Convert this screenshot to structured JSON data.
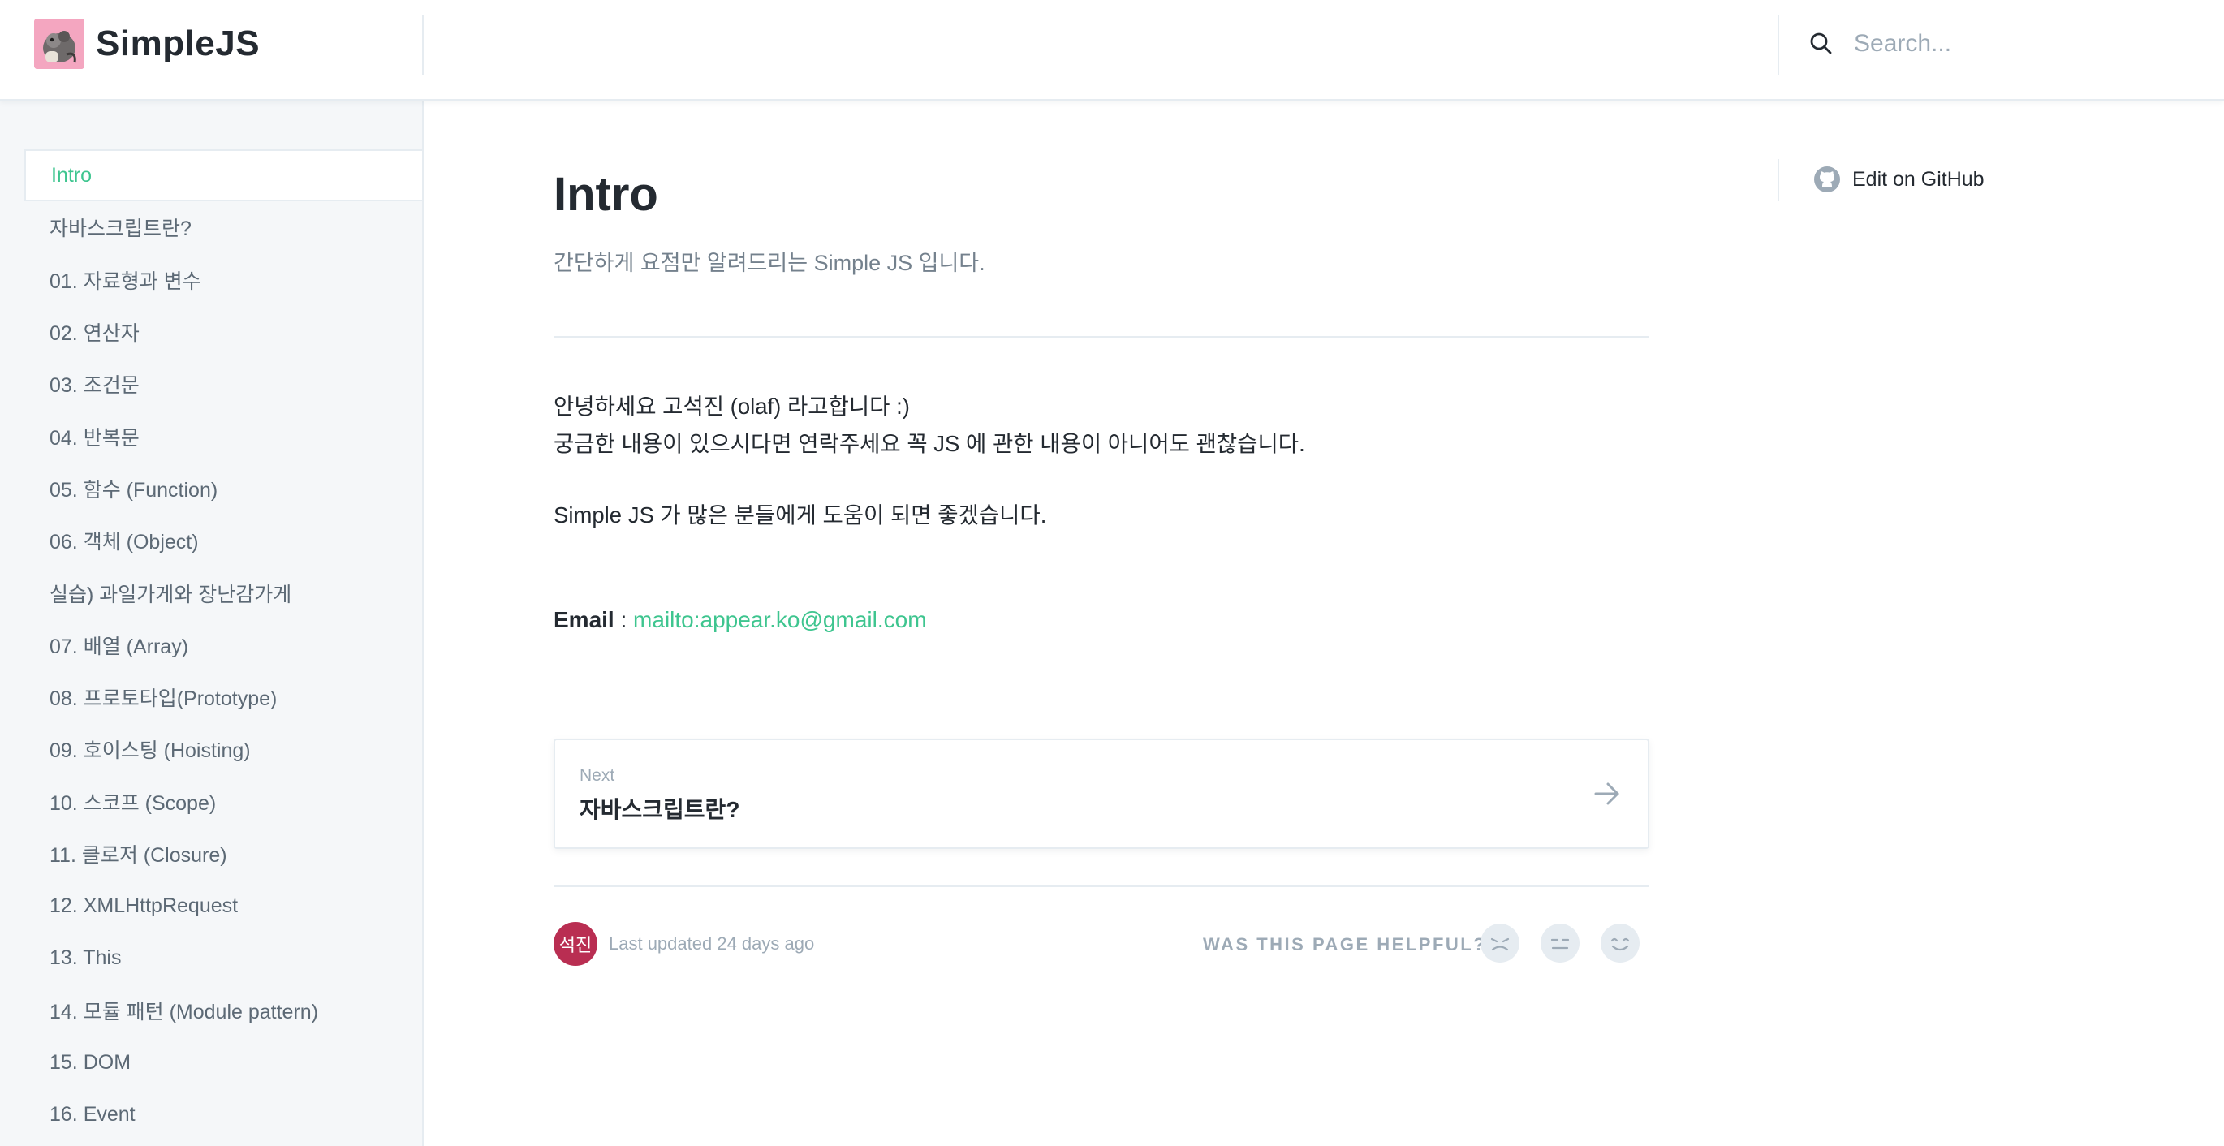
{
  "header": {
    "brand_name": "SimpleJS",
    "search_placeholder": "Search..."
  },
  "sidebar": {
    "items": [
      {
        "label": "Intro",
        "active": true
      },
      {
        "label": "자바스크립트란?"
      },
      {
        "label": "01. 자료형과 변수"
      },
      {
        "label": "02. 연산자"
      },
      {
        "label": "03. 조건문"
      },
      {
        "label": "04. 반복문"
      },
      {
        "label": "05. 함수 (Function)"
      },
      {
        "label": "06. 객체 (Object)"
      },
      {
        "label": "실습) 과일가게와 장난감가게"
      },
      {
        "label": "07. 배열 (Array)"
      },
      {
        "label": "08. 프로토타입(Prototype)"
      },
      {
        "label": "09. 호이스팅 (Hoisting)"
      },
      {
        "label": "10. 스코프 (Scope)"
      },
      {
        "label": "11. 클로저 (Closure)"
      },
      {
        "label": "12. XMLHttpRequest"
      },
      {
        "label": "13. This"
      },
      {
        "label": "14. 모듈 패턴 (Module pattern)"
      },
      {
        "label": "15. DOM"
      },
      {
        "label": "16. Event"
      }
    ]
  },
  "main": {
    "title": "Intro",
    "subtitle": "간단하게 요점만 알려드리는 Simple JS 입니다.",
    "paragraphs": [
      "안녕하세요 고석진 (olaf) 라고합니다 :)",
      "궁금한 내용이 있으시다면 연락주세요 꼭 JS 에 관한 내용이 아니어도 괜찮습니다.",
      "Simple JS 가 많은 분들에게 도움이 되면 좋겠습니다."
    ],
    "email_label": "Email",
    "email_sep": " : ",
    "email_link": "mailto:appear.ko@gmail.com",
    "next": {
      "label": "Next",
      "title": "자바스크립트란?"
    },
    "footer": {
      "avatar_text": "석진",
      "last_updated": "Last updated 24 days ago",
      "helpful_question": "WAS THIS PAGE HELPFUL?"
    }
  },
  "right": {
    "edit_label": "Edit on GitHub"
  },
  "colors": {
    "accent": "#3ec58f",
    "text": "#242a31",
    "muted": "#9daab6",
    "border": "#e6ecf1",
    "sidebar_bg": "#f5f7f9",
    "avatar_bg": "#b92e52"
  },
  "icons": [
    "brand-logo",
    "search-icon",
    "github-icon",
    "arrow-right-icon",
    "sad-face-icon",
    "neutral-face-icon",
    "happy-face-icon"
  ]
}
